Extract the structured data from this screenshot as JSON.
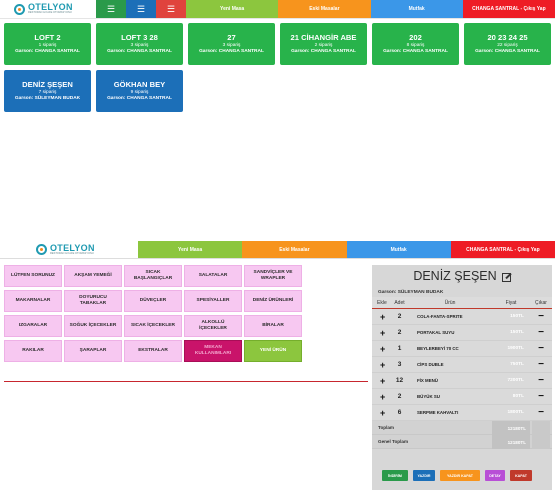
{
  "brand": {
    "name": "OTELYON",
    "tagline": "RESTORAN & KAFE OTOMASYONU",
    "color": "#1f9ab1"
  },
  "top_icons": [
    {
      "icon": "sitemap-icon",
      "color": "#2a9a4a"
    },
    {
      "icon": "sitemap-icon",
      "color": "#1c6fb8"
    },
    {
      "icon": "sitemap-icon",
      "color": "#e0433d"
    }
  ],
  "nav": [
    {
      "label": "Yeni Masa",
      "color": "#8cc63e"
    },
    {
      "label": "Eski Masalar",
      "color": "#f7941d"
    },
    {
      "label": "Mutfak",
      "color": "#3b97e8"
    },
    {
      "label": "CHANGA SANTRAL - Çıkış Yap",
      "color": "#ee1c25"
    }
  ],
  "tables": [
    {
      "name": "LOFT 2",
      "orders": "1 sipariş",
      "waiter": "Garson: CHANGA SANTRAL",
      "color": "#28b34b"
    },
    {
      "name": "LOFT 3 28",
      "orders": "3 sipariş",
      "waiter": "Garson: CHANGA SANTRAL",
      "color": "#28b34b"
    },
    {
      "name": "27",
      "orders": "3 sipariş",
      "waiter": "Garson: CHANGA SANTRAL",
      "color": "#28b34b"
    },
    {
      "name": "21 CİHANGİR ABE",
      "orders": "2 sipariş",
      "waiter": "Garson: CHANGA SANTRAL",
      "color": "#28b34b"
    },
    {
      "name": "202",
      "orders": "8 sipariş",
      "waiter": "Garson: CHANGA SANTRAL",
      "color": "#28b34b"
    },
    {
      "name": "20 23 24 25",
      "orders": "22 sipariş",
      "waiter": "Garson: CHANGA SANTRAL",
      "color": "#28b34b"
    },
    {
      "name": "DENİZ ŞEŞEN",
      "orders": "7 sipariş",
      "waiter": "Garson: SÜLEYMAN BUDAK",
      "color": "#1c6fb8"
    },
    {
      "name": "GÖKHAN BEY",
      "orders": "9 sipariş",
      "waiter": "Garson: CHANGA SANTRAL",
      "color": "#1c6fb8"
    }
  ],
  "categories": [
    {
      "label": "LÜTFEN SORUNUZ",
      "style": "pink"
    },
    {
      "label": "AKŞAM YEMEĞİ",
      "style": "pink"
    },
    {
      "label": "SICAK BAŞLANGIÇLAR",
      "style": "pink"
    },
    {
      "label": "SALATALAR",
      "style": "pink"
    },
    {
      "label": "SANDVİÇLER VE WRAPLER",
      "style": "pink"
    },
    {
      "label": "MAKARNALAR",
      "style": "pink"
    },
    {
      "label": "DOYURUCU TABAKLAR",
      "style": "pink"
    },
    {
      "label": "DÜVEÇLER",
      "style": "pink"
    },
    {
      "label": "SPESİYALLER",
      "style": "pink"
    },
    {
      "label": "DENİZ ÜRÜNLERİ",
      "style": "pink"
    },
    {
      "label": "IZGARALAR",
      "style": "pink"
    },
    {
      "label": "SOĞUK İÇECEKLER",
      "style": "pink"
    },
    {
      "label": "SICAK İÇECEKLER",
      "style": "pink"
    },
    {
      "label": "ALKOLLÜ İÇECEKLER",
      "style": "pink"
    },
    {
      "label": "BİRALAR",
      "style": "pink"
    },
    {
      "label": "RAKILAR",
      "style": "pink"
    },
    {
      "label": "ŞARAPLAR",
      "style": "pink"
    },
    {
      "label": "EKSTRALAR",
      "style": "pink"
    },
    {
      "label": "MEKAN KULLANIMLARI",
      "style": "dark"
    },
    {
      "label": "YENİ ÜRÜN",
      "style": "green"
    }
  ],
  "order": {
    "title": "DENİZ ŞEŞEN",
    "waiter": "Garson: SÜLEYMAN BUDAK",
    "headers": {
      "add": "Ekle",
      "qty": "Adet",
      "product": "Ürün",
      "price": "Fiyat",
      "remove": "Çıkar"
    },
    "add_symbol": "+",
    "remove_symbol": "−",
    "items": [
      {
        "qty": "2",
        "product": "COLA-FANTA-SPRITE",
        "price": "150TL"
      },
      {
        "qty": "2",
        "product": "PORTAKAL SUYU",
        "price": "150TL"
      },
      {
        "qty": "1",
        "product": "BEYLERBEYİ 70 CC",
        "price": "1900TL"
      },
      {
        "qty": "3",
        "product": "CİPS DUBLE",
        "price": "750TL"
      },
      {
        "qty": "12",
        "product": "FİX MENÜ",
        "price": "7200TL"
      },
      {
        "qty": "2",
        "product": "BÜYÜK SU",
        "price": "80TL"
      },
      {
        "qty": "6",
        "product": "SERPME KAHVALTI",
        "price": "1800TL"
      }
    ],
    "total_label": "Toplam",
    "total_value": "12180TL",
    "grand_total_label": "Genel Toplam",
    "grand_total_value": "12180TL",
    "buttons": [
      {
        "label": "İNDİRİM",
        "color": "#2a9a4a"
      },
      {
        "label": "YAZDIR",
        "color": "#1c6fb8"
      },
      {
        "label": "YAZDIR KAPAT",
        "color": "#f7941d"
      },
      {
        "label": "DETAY",
        "color": "#b84fd6"
      },
      {
        "label": "KAPAT",
        "color": "#c0392b"
      }
    ]
  }
}
